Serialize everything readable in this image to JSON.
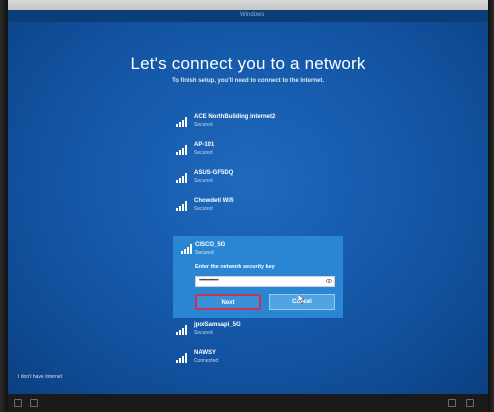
{
  "screen": {
    "top_label": "Windows",
    "title": "Let's connect you to a network",
    "subtitle": "To finish setup, you'll need to connect to the Internet."
  },
  "networks": [
    {
      "name": "ACE NorthBuilding internet2",
      "status": "Secured"
    },
    {
      "name": "AP-101",
      "status": "Secured"
    },
    {
      "name": "ASUS-GF5DQ",
      "status": "Secured"
    },
    {
      "name": "Chowdeti Wifi",
      "status": "Secured"
    }
  ],
  "selected_network": {
    "name": "CISCO_5G",
    "status": "Secured",
    "key_label": "Enter the network security key",
    "key_value": "••••••••••••",
    "next_label": "Next",
    "cancel_label": "Cancel"
  },
  "networks_after": [
    {
      "name": "jpoiSamsapi_5G",
      "status": "Secured"
    },
    {
      "name": "NAWSY",
      "status": "Connected"
    }
  ],
  "footer": {
    "link": "I don't have Internet"
  },
  "colors": {
    "background": "#1559aa",
    "selected_panel": "#2a86d3",
    "next_outline": "#c8325a"
  },
  "icons": {
    "network": "wifi-signal-icon",
    "reveal": "eye-icon",
    "pointer": "mouse-cursor-icon"
  }
}
